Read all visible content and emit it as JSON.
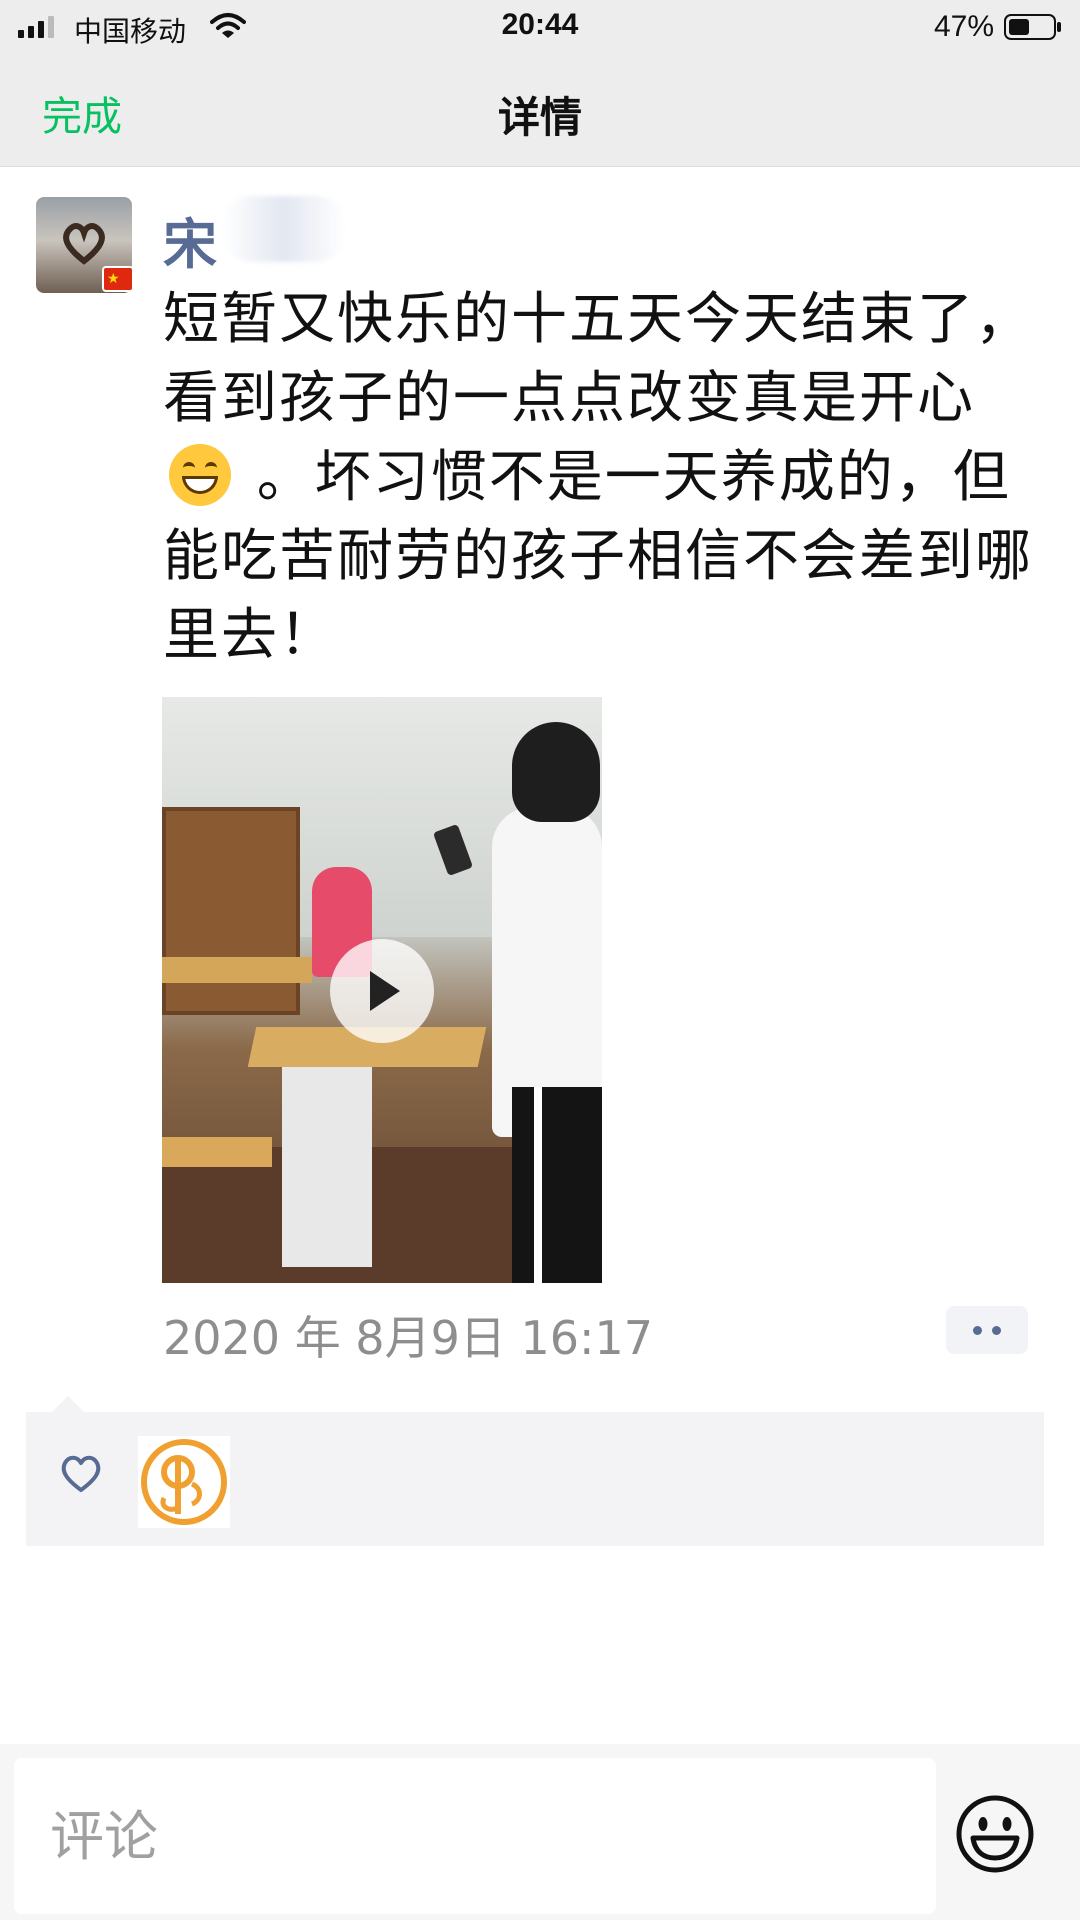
{
  "status_bar": {
    "carrier": "中国移动",
    "time": "20:44",
    "battery_percent": "47%",
    "battery_level": 0.47,
    "signal_bars": 3
  },
  "nav": {
    "done_label": "完成",
    "title": "详情"
  },
  "post": {
    "username": "宋",
    "content_part1": "短暂又快乐的十五天今天结束了，看到孩子的一点点改变真是开心",
    "content_part2": " 。坏习惯不是一天养成的，但能吃苦耐劳的孩子相信不会差到哪里去！",
    "timestamp": "2020 年 8月9日 16:17"
  },
  "comment": {
    "placeholder": "评论"
  },
  "colors": {
    "accent_green": "#07c160",
    "name_blue": "#576b95",
    "liker_orange": "#f0a030"
  },
  "icons": [
    "signal-icon",
    "wifi-icon",
    "battery-icon",
    "play-icon",
    "more-icon",
    "heart-icon",
    "emoji-icon"
  ]
}
